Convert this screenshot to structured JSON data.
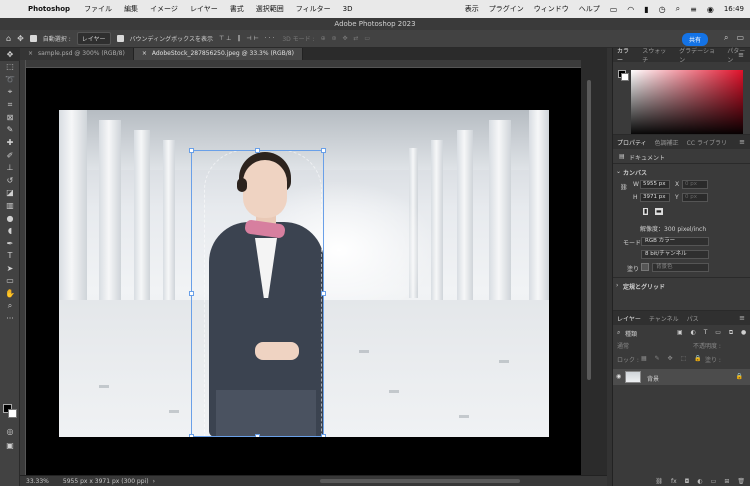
{
  "menubar": {
    "app_name": "Photoshop",
    "items": [
      "ファイル",
      "編集",
      "イメージ",
      "レイヤー",
      "書式",
      "選択範囲",
      "フィルター",
      "3D"
    ],
    "right_items": [
      "表示",
      "プラグイン",
      "ウィンドウ",
      "ヘルプ"
    ],
    "time": "16:49"
  },
  "window": {
    "title": "Adobe Photoshop 2023"
  },
  "options_bar": {
    "auto_select_label": "自動選択 :",
    "auto_select_value": "レイヤー",
    "bbox_label": "バウンディングボックスを表示",
    "mode3d_label": "3D モード :",
    "share_label": "共有"
  },
  "tabs": [
    {
      "label": "sample.psd @ 300% (RGB/8)",
      "active": false
    },
    {
      "label": "AdobeStock_287856250.jpeg @ 33.3% (RGB/8)",
      "active": true
    }
  ],
  "status": {
    "zoom": "33.33%",
    "doc_info": "5955 px x 3971 px (300 ppi)"
  },
  "panels": {
    "color_tabs": [
      "カラー",
      "スウォッチ",
      "グラデーション",
      "パターン"
    ],
    "props_tabs": [
      "プロパティ",
      "色調補正",
      "CC ライブラリ"
    ],
    "document_label": "ドキュメント",
    "canvas_label": "カンバス",
    "width_label": "W",
    "width_value": "5955 px",
    "height_label": "H",
    "height_value": "3971 px",
    "x_label": "X",
    "x_value": "0 px",
    "y_label": "Y",
    "y_value": "0 px",
    "resolution": "解像度：300 pixel/inch",
    "mode_label": "モード",
    "mode_value": "RGB カラー",
    "bitdepth_value": "8 bit/チャンネル",
    "fill_label": "塗り",
    "fill_value": "背景色",
    "rulers_label": "定規とグリッド",
    "layer_tabs": [
      "レイヤー",
      "チャンネル",
      "パス"
    ],
    "kind_label": "種類",
    "blend_mode": "通常",
    "opacity_label": "不透明度 :",
    "lock_label": "ロック :",
    "fill2_label": "塗り :",
    "layer_name": "背景"
  },
  "colors": {
    "accent": "#1473e6",
    "selection": "#6aa0e8"
  }
}
